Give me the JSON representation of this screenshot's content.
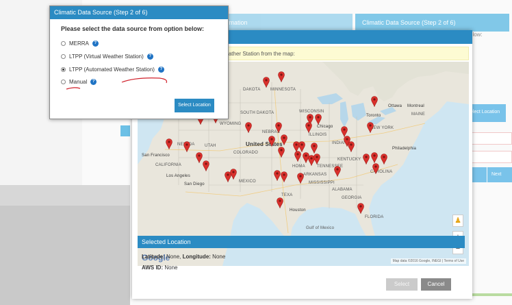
{
  "background": {
    "tabs": [
      {
        "label": "ject Information"
      },
      {
        "label": "Climatic Data Source (Step 2 of 6)"
      }
    ],
    "side_text": "elow:",
    "side_button_label": "elect Location",
    "next_button_label": "Next"
  },
  "source_dialog": {
    "title": "Climatic Data Source (Step 2 of 6)",
    "prompt": "Please select the data source from option below:",
    "options": [
      {
        "label": "MERRA",
        "selected": false
      },
      {
        "label": "LTPP (Virtual Weather Station)",
        "selected": false
      },
      {
        "label": "LTPP (Automated Weather Station)",
        "selected": true
      },
      {
        "label": "Manual",
        "selected": false
      }
    ],
    "help_symbol": "?",
    "select_button_label": "Select Location"
  },
  "map_modal": {
    "notice": "Weather Station from the map:",
    "map": {
      "labels": {
        "united_states": "United States",
        "minnesota": "MINNESOTA",
        "dakota": "DAKOTA",
        "south_dakota": "SOUTH DAKOTA",
        "wisconsin": "WISCONSIN",
        "wyoming": "WYOMING",
        "nebraska": "NEBRAS",
        "nevada": "NEVADA",
        "utah": "UTAH",
        "colorado": "COLORADO",
        "california": "CALIFORNIA",
        "mexico": "MEXICO",
        "texas": "TEXA",
        "oklahoma": "HOMA",
        "kentucky": "KENTUCKY",
        "indiana": "INDIANA",
        "illinois": "ILLINOIS",
        "mississippi": "MISSISSIPPI",
        "alabama": "ALABAMA",
        "georgia": "GEORGIA",
        "florida": "FLORIDA",
        "carolina": "CAROLINA",
        "new_york": "NEW YORK",
        "maine": "MAINE",
        "chicago": "Chicago",
        "ottawa": "Ottawa",
        "montreal": "Montreal",
        "toronto": "Toronto",
        "philadelphia": "Philadelphia",
        "san_francisco": "San Francisco",
        "los_angeles": "Los Angeles",
        "san_diego": "San Diego",
        "houston": "Houston",
        "gulf_of_mexico": "Gulf of Mexico",
        "ark": "ARKANSAS",
        "tennessee": "TENNESSEE"
      },
      "google_logo": "Google",
      "credit": "Map data ©2016 Google, INEGI  |  Terms of Use",
      "pegman_symbol": "♟",
      "zoom_in": "+",
      "zoom_out": "−",
      "pin_color": "#d9302c"
    },
    "selected_location_title": "Selected Location",
    "latitude_label": "Latitude:",
    "latitude_value": "None,",
    "longitude_label": "Longitude:",
    "longitude_value": "None",
    "aws_label": "AWS ID:",
    "aws_value": "None",
    "select_button_label": "Select",
    "cancel_button_label": "Cancel"
  }
}
